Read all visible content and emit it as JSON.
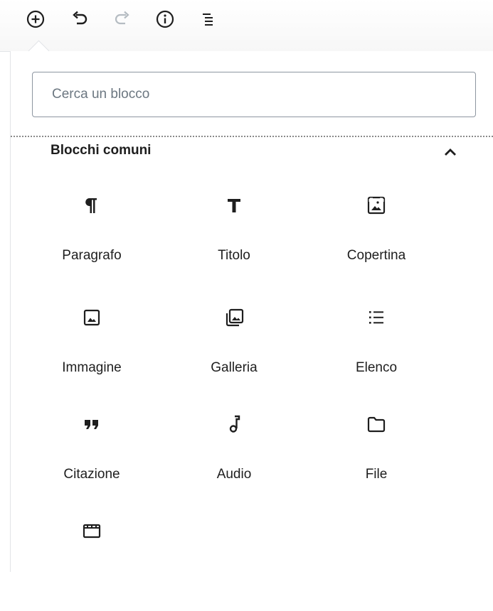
{
  "toolbar": {
    "icons": [
      "add-block-icon",
      "undo-icon",
      "redo-icon",
      "info-icon",
      "block-navigation-icon"
    ]
  },
  "search": {
    "placeholder": "Cerca un blocco"
  },
  "panel": {
    "title": "Blocchi comuni",
    "expanded": true
  },
  "blocks": [
    {
      "label": "Paragrafo",
      "icon": "paragraph-icon"
    },
    {
      "label": "Titolo",
      "icon": "heading-icon"
    },
    {
      "label": "Copertina",
      "icon": "cover-icon"
    },
    {
      "label": "Immagine",
      "icon": "image-icon"
    },
    {
      "label": "Galleria",
      "icon": "gallery-icon"
    },
    {
      "label": "Elenco",
      "icon": "list-icon"
    },
    {
      "label": "Citazione",
      "icon": "quote-icon"
    },
    {
      "label": "Audio",
      "icon": "audio-icon"
    },
    {
      "label": "File",
      "icon": "file-icon"
    },
    {
      "label": "",
      "icon": "video-icon"
    }
  ],
  "colors": {
    "icon": "#1e1e1e",
    "disabled_icon": "#b5bcc2",
    "border": "#8d96a0"
  }
}
